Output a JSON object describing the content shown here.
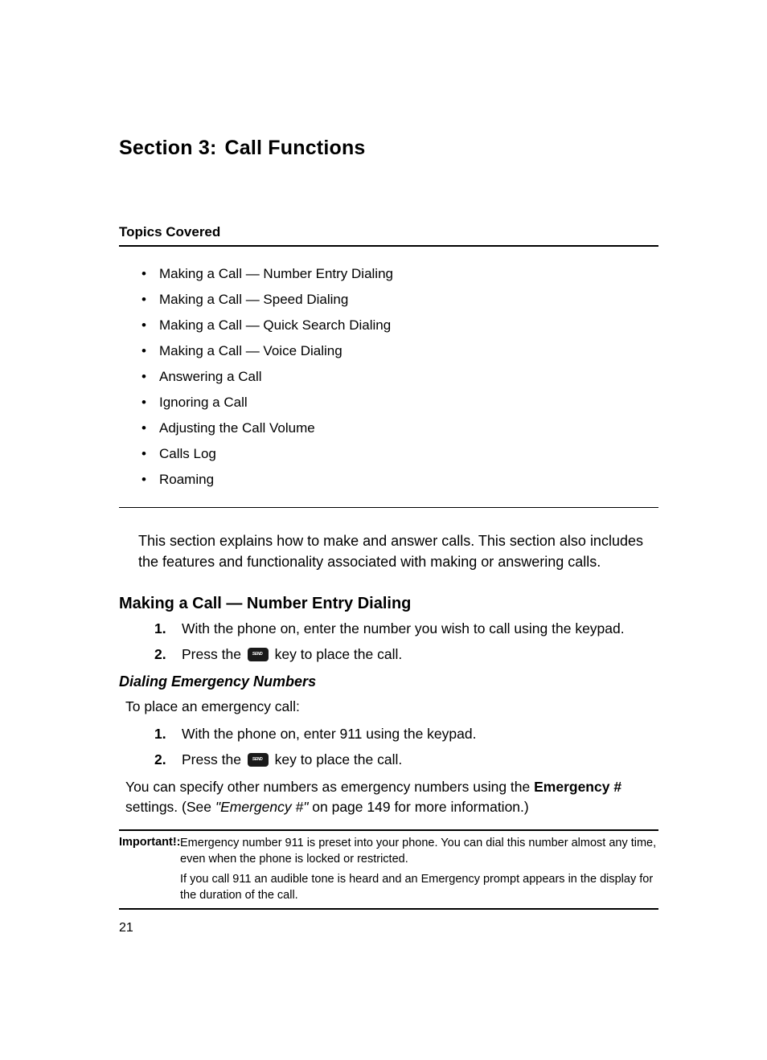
{
  "title_prefix": "Section 3:",
  "title_main": "Call Functions",
  "topics_label": "Topics Covered",
  "topics": [
    "Making a Call — Number Entry Dialing",
    "Making a Call — Speed Dialing",
    "Making a Call — Quick Search Dialing",
    "Making a Call — Voice Dialing",
    "Answering a Call",
    "Ignoring a Call",
    "Adjusting the Call Volume",
    "Calls Log",
    "Roaming"
  ],
  "intro": "This section explains how to make and answer calls. This section also includes the features and functionality associated with making or answering calls.",
  "h2_1": "Making a Call — Number Entry Dialing",
  "steps1": {
    "s1": "With the phone on, enter the number you wish to call using the keypad.",
    "s2a": "Press the ",
    "s2b": " key to place the call."
  },
  "h3_1": "Dialing Emergency Numbers",
  "emerg_lead": "To place an emergency call:",
  "steps2": {
    "s1": "With the phone on, enter 911 using the keypad.",
    "s2a": "Press the ",
    "s2b": " key to place the call."
  },
  "emerg_tail_a": "You can specify other numbers as emergency numbers using the ",
  "emerg_tail_bold": "Emergency #",
  "emerg_tail_b": " settings. (See ",
  "emerg_tail_ital": "\"Emergency #\"",
  "emerg_tail_c": " on page 149 for more information.)",
  "note_label": "Important!:",
  "note1": "Emergency number 911 is preset into your phone. You can dial this number almost any time, even when the phone is locked or restricted.",
  "note2": "If you call 911 an audible tone is heard and an Emergency prompt appears in the display for the duration of the call.",
  "pagenum": "21"
}
